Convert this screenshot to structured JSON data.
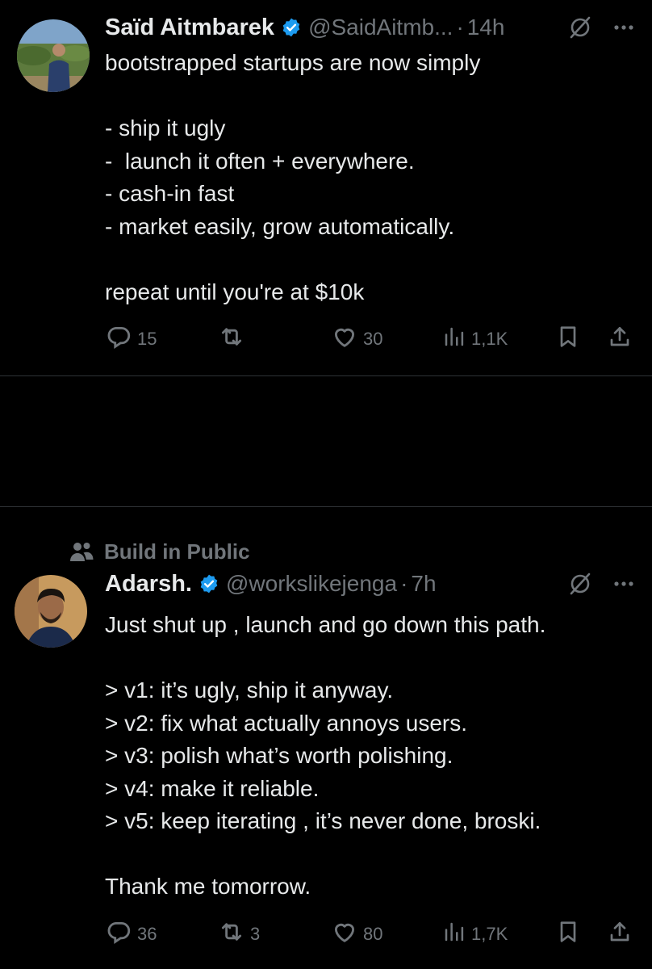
{
  "colors": {
    "background": "#000000",
    "text": "#e7e9ea",
    "muted": "#71767b",
    "verified": "#1d9bf0",
    "divider": "#2f3336"
  },
  "tweets": [
    {
      "author": {
        "name": "Saïd Aitmbarek",
        "handle": "@SaidAitmb...",
        "verified": true
      },
      "time": "14h",
      "text": "bootstrapped startups are now simply\n\n- ship it ugly\n-  launch it often + everywhere.\n- cash-in fast\n- market easily, grow automatically.\n\nrepeat until you're at $10k",
      "stats": {
        "replies": "15",
        "reposts": "",
        "likes": "30",
        "views": "1,1K"
      }
    },
    {
      "context": "Build in Public",
      "author": {
        "name": "Adarsh.",
        "handle": "@workslikejenga",
        "verified": true
      },
      "time": "7h",
      "text": "Just shut up , launch and go down this path.\n\n> v1: it’s ugly, ship it anyway.\n> v2: fix what actually annoys users.\n> v3: polish what’s worth polishing.\n> v4: make it reliable.\n> v5: keep iterating , it’s never done, broski.\n\nThank me tomorrow.",
      "stats": {
        "replies": "36",
        "reposts": "3",
        "likes": "80",
        "views": "1,7K"
      }
    }
  ],
  "icons": [
    "reply-icon",
    "repost-icon",
    "like-icon",
    "views-icon",
    "bookmark-icon",
    "share-icon",
    "grok-icon",
    "more-icon",
    "verified-icon",
    "community-icon"
  ]
}
